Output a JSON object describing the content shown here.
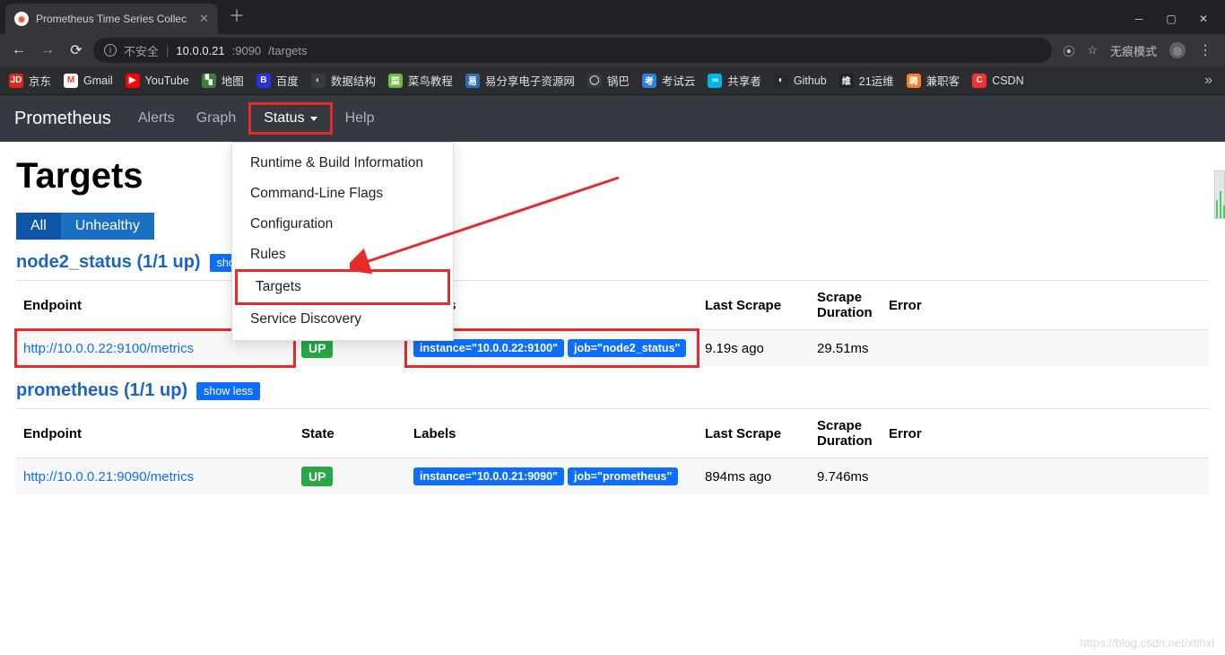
{
  "browser": {
    "tab_title": "Prometheus Time Series Collec",
    "url_insecure_label": "不安全",
    "url_host": "10.0.0.21",
    "url_port": ":9090",
    "url_path": "/targets",
    "incognito_label": "无痕模式"
  },
  "bookmarks": [
    {
      "label": "京东",
      "bg": "#e1251b",
      "fg": "#fff",
      "txt": "JD"
    },
    {
      "label": "Gmail",
      "bg": "#fff",
      "fg": "#ea4335",
      "txt": "M"
    },
    {
      "label": "YouTube",
      "bg": "#ff0000",
      "fg": "#fff",
      "txt": "▶"
    },
    {
      "label": "地图",
      "bg": "#3b7f3b",
      "fg": "#fff",
      "txt": "▚"
    },
    {
      "label": "百度",
      "bg": "#2932e1",
      "fg": "#fff",
      "txt": "B"
    },
    {
      "label": "数据结构",
      "bg": "#3a3a3a",
      "fg": "#ccc",
      "txt": "◐"
    },
    {
      "label": "菜鸟教程",
      "bg": "#6fbb3b",
      "fg": "#fff",
      "txt": "菜"
    },
    {
      "label": "易分享电子资源网",
      "bg": "#2a6fb5",
      "fg": "#fff",
      "txt": "易"
    },
    {
      "label": "锅巴",
      "bg": "#3a3a3a",
      "fg": "#ddd",
      "txt": "◯"
    },
    {
      "label": "考试云",
      "bg": "#2d7fe0",
      "fg": "#fff",
      "txt": "考"
    },
    {
      "label": "共享者",
      "bg": "#00b4e6",
      "fg": "#fff",
      "txt": "∞"
    },
    {
      "label": "Github",
      "bg": "#24292e",
      "fg": "#fff",
      "txt": "◐"
    },
    {
      "label": "21运维",
      "bg": "#222",
      "fg": "#fff",
      "txt": "维"
    },
    {
      "label": "兼职客",
      "bg": "#ff7a1a",
      "fg": "#fff",
      "txt": "聘"
    },
    {
      "label": "CSDN",
      "bg": "#f73131",
      "fg": "#fff",
      "txt": "C"
    }
  ],
  "nav": {
    "brand": "Prometheus",
    "alerts": "Alerts",
    "graph": "Graph",
    "status": "Status",
    "help": "Help"
  },
  "dropdown": {
    "runtime": "Runtime & Build Information",
    "cmdline": "Command-Line Flags",
    "config": "Configuration",
    "rules": "Rules",
    "targets": "Targets",
    "sd": "Service Discovery"
  },
  "page": {
    "title": "Targets",
    "all_btn": "All",
    "unhealthy_btn": "Unhealthy",
    "show_less": "show less",
    "show_partial": "show"
  },
  "th": {
    "endpoint": "Endpoint",
    "state": "State",
    "labels": "Labels",
    "last_scrape": "Last Scrape",
    "scrape_duration": "Scrape Duration",
    "error": "Error"
  },
  "groups": [
    {
      "name": "node2_status (1/1 up)",
      "red_section_title": false,
      "rows": [
        {
          "endpoint": "http://10.0.0.22:9100/metrics",
          "endpoint_red": true,
          "state": "UP",
          "labels": [
            "instance=\"10.0.0.22:9100\"",
            "job=\"node2_status\""
          ],
          "labels_red": true,
          "last_scrape": "9.19s ago",
          "duration": "29.51ms",
          "error": ""
        }
      ]
    },
    {
      "name": "prometheus (1/1 up)",
      "rows": [
        {
          "endpoint": "http://10.0.0.21:9090/metrics",
          "endpoint_red": false,
          "state": "UP",
          "labels": [
            "instance=\"10.0.0.21:9090\"",
            "job=\"prometheus\""
          ],
          "labels_red": false,
          "last_scrape": "894ms ago",
          "duration": "9.746ms",
          "error": ""
        }
      ]
    }
  ],
  "watermark": "https://blog.csdn.net/xtlhxl"
}
